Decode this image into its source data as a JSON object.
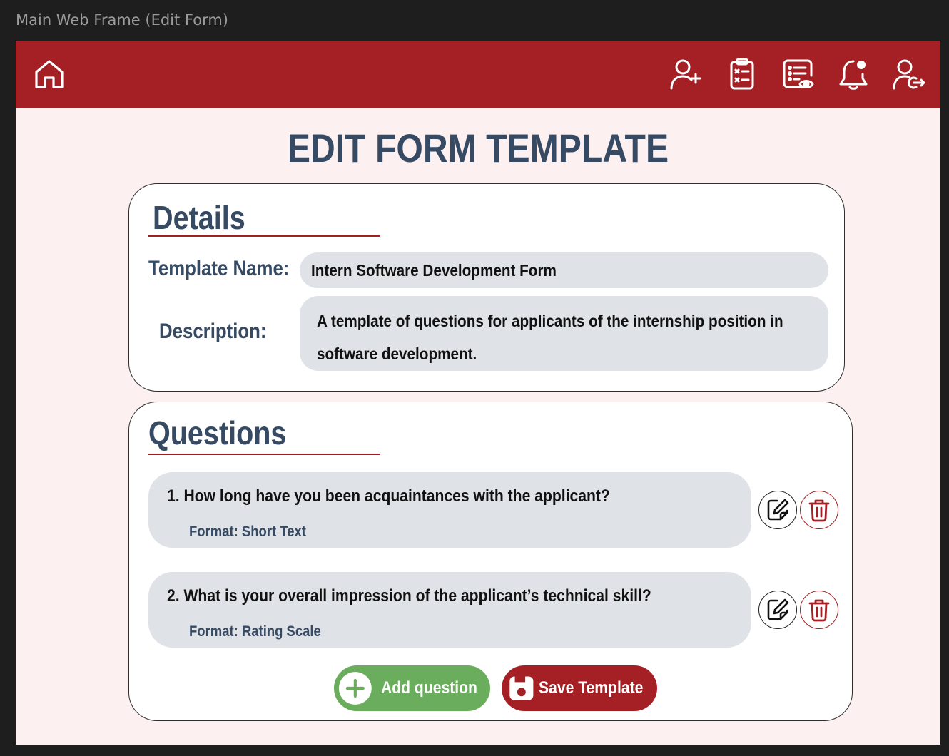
{
  "window": {
    "title": "Main Web Frame (Edit Form)"
  },
  "navbar": {
    "icons": [
      "home-icon",
      "add-user-icon",
      "clipboard-checklist-icon",
      "view-forms-icon",
      "notification-bell-icon",
      "logout-icon"
    ]
  },
  "page": {
    "title": "EDIT FORM TEMPLATE"
  },
  "details": {
    "heading": "Details",
    "template_name_label": "Template Name:",
    "template_name_value": "Intern Software Development Form",
    "description_label": "Description:",
    "description_value": "A template of questions for applicants of the internship position in software development."
  },
  "questions": {
    "heading": "Questions",
    "items": [
      {
        "text": "1.  How long have you been acquaintances with the applicant?",
        "format": "Format: Short Text"
      },
      {
        "text": "2.  What is your overall impression of the applicant’s technical skill?",
        "format": "Format: Rating Scale"
      }
    ],
    "add_label": "Add question",
    "save_label": "Save Template"
  },
  "colors": {
    "brand_red": "#a52024",
    "title_navy": "#364a63",
    "background_pink": "#fdf0f1",
    "field_gray": "#dfe2e7",
    "add_green": "#6aad5c"
  }
}
